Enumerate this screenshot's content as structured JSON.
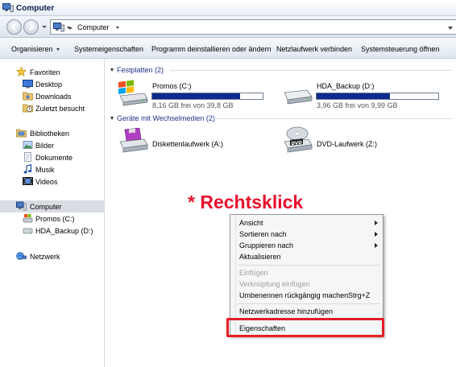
{
  "window": {
    "title": "Computer"
  },
  "address": {
    "location": "Computer"
  },
  "commandbar": {
    "organize": "Organisieren",
    "system_properties": "Systemeigenschaften",
    "uninstall": "Programm deinstallieren oder ändern",
    "map_drive": "Netzlaufwerk verbinden",
    "control_panel": "Systemsteuerung öffnen"
  },
  "navpane": {
    "favorites": "Favoriten",
    "desktop": "Desktop",
    "downloads": "Downloads",
    "recent": "Zuletzt besucht",
    "libraries": "Bibliotheken",
    "pictures": "Bilder",
    "documents": "Dokumente",
    "music": "Musik",
    "videos": "Videos",
    "computer": "Computer",
    "drive_c": "Promos (C:)",
    "drive_d": "HDA_Backup (D:)",
    "network": "Netzwerk"
  },
  "content": {
    "hard_disks_header": "Festplatten (2)",
    "removable_header": "Geräte mit Wechselmedien (2)",
    "drives": [
      {
        "name": "Promos (C:)",
        "free_text": "8,16 GB frei von 39,8 GB",
        "used_fraction": 0.795
      },
      {
        "name": "HDA_Backup (D:)",
        "free_text": "3,96 GB frei von 9,99 GB",
        "used_fraction": 0.604
      }
    ],
    "removable": [
      {
        "name": "Diskettenlaufwerk (A:)"
      },
      {
        "name": "DVD-Laufwerk (Z:)"
      }
    ]
  },
  "annotation": "* Rechtsklick",
  "context_menu": {
    "view": "Ansicht",
    "sort_by": "Sortieren nach",
    "group_by": "Gruppieren nach",
    "refresh": "Aktualisieren",
    "paste": "Einfügen",
    "paste_shortcut": "Verknüpfung einfügen",
    "undo_rename": "Umbenennen rückgängig machen",
    "undo_shortcut": "Strg+Z",
    "add_network_location": "Netzwerkadresse hinzufügen",
    "properties": "Eigenschaften"
  },
  "colors": {
    "annotation_red": "#e8112d",
    "drive_bar": "#0e2a8c",
    "group_header": "#1e3287"
  }
}
